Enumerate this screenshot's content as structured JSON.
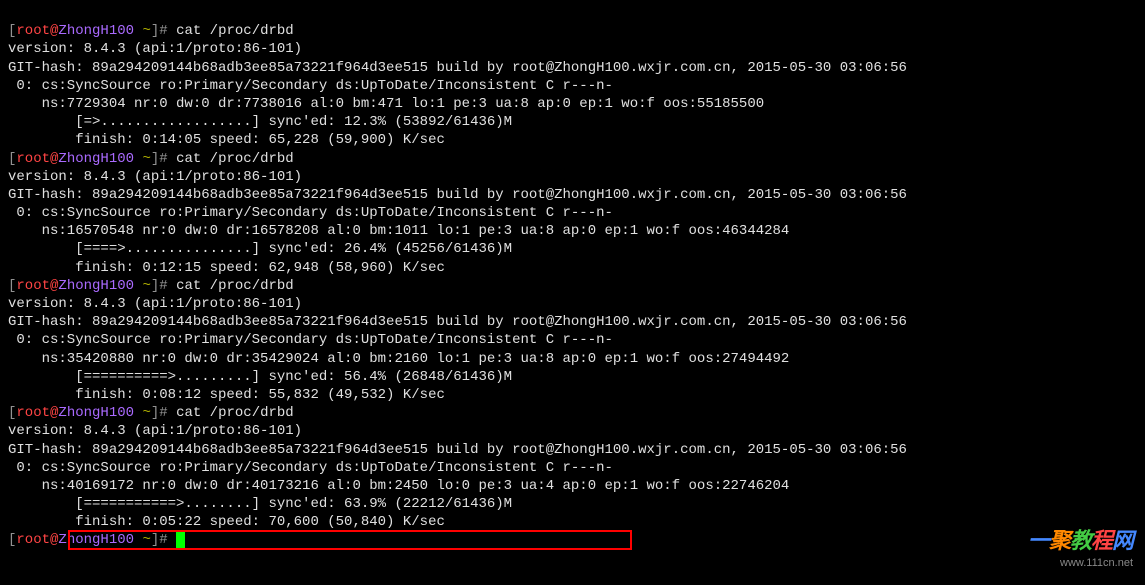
{
  "prompt": {
    "lbracket": "[",
    "user": "root",
    "at": "@",
    "host": "ZhongH100",
    "tilde": " ~",
    "rbracket": "]",
    "hash": "# "
  },
  "cmd": "cat /proc/drbd",
  "block1": {
    "version": "version: 8.4.3 (api:1/proto:86-101)",
    "githash": "GIT-hash: 89a294209144b68adb3ee85a73221f964d3ee515 build by root@ZhongH100.wxjr.com.cn, 2015-05-30 03:06:56",
    "status": " 0: cs:SyncSource ro:Primary/Secondary ds:UpToDate/Inconsistent C r---n-",
    "ns": "    ns:7729304 nr:0 dw:0 dr:7738016 al:0 bm:471 lo:1 pe:3 ua:8 ap:0 ep:1 wo:f oos:55185500",
    "progress": "        [=>..................] sync'ed: 12.3% (53892/61436)M",
    "finish": "        finish: 0:14:05 speed: 65,228 (59,900) K/sec"
  },
  "block2": {
    "version": "version: 8.4.3 (api:1/proto:86-101)",
    "githash": "GIT-hash: 89a294209144b68adb3ee85a73221f964d3ee515 build by root@ZhongH100.wxjr.com.cn, 2015-05-30 03:06:56",
    "status": " 0: cs:SyncSource ro:Primary/Secondary ds:UpToDate/Inconsistent C r---n-",
    "ns": "    ns:16570548 nr:0 dw:0 dr:16578208 al:0 bm:1011 lo:1 pe:3 ua:8 ap:0 ep:1 wo:f oos:46344284",
    "progress": "        [====>...............] sync'ed: 26.4% (45256/61436)M",
    "finish": "        finish: 0:12:15 speed: 62,948 (58,960) K/sec"
  },
  "block3": {
    "version": "version: 8.4.3 (api:1/proto:86-101)",
    "githash": "GIT-hash: 89a294209144b68adb3ee85a73221f964d3ee515 build by root@ZhongH100.wxjr.com.cn, 2015-05-30 03:06:56",
    "status": " 0: cs:SyncSource ro:Primary/Secondary ds:UpToDate/Inconsistent C r---n-",
    "ns": "    ns:35420880 nr:0 dw:0 dr:35429024 al:0 bm:2160 lo:1 pe:3 ua:8 ap:0 ep:1 wo:f oos:27494492",
    "progress": "        [==========>.........] sync'ed: 56.4% (26848/61436)M",
    "finish": "        finish: 0:08:12 speed: 55,832 (49,532) K/sec"
  },
  "block4": {
    "version": "version: 8.4.3 (api:1/proto:86-101)",
    "githash": "GIT-hash: 89a294209144b68adb3ee85a73221f964d3ee515 build by root@ZhongH100.wxjr.com.cn, 2015-05-30 03:06:56",
    "status": " 0: cs:SyncSource ro:Primary/Secondary ds:UpToDate/Inconsistent C r---n-",
    "ns": "    ns:40169172 nr:0 dw:0 dr:40173216 al:0 bm:2450 lo:0 pe:3 ua:4 ap:0 ep:1 wo:f oos:22746204",
    "progress": "        [===========>........] sync'ed: 63.9% (22212/61436)M",
    "finish": "        finish: 0:05:22 speed: 70,600 (50,840) K/sec"
  },
  "watermark": {
    "text": "一聚教程网",
    "url": "www.111cn.net"
  }
}
